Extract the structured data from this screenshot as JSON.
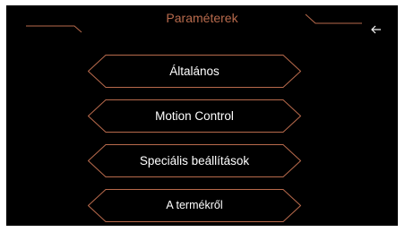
{
  "header": {
    "title": "Paraméterek",
    "back_icon": "arrow-left-icon"
  },
  "menu": {
    "items": [
      {
        "label": "Általános"
      },
      {
        "label": "Motion Control"
      },
      {
        "label": "Speciális beállítások"
      },
      {
        "label": "A termékről"
      }
    ]
  },
  "colors": {
    "background": "#000000",
    "accent": "#b86a4c",
    "text": "#ffffff"
  }
}
